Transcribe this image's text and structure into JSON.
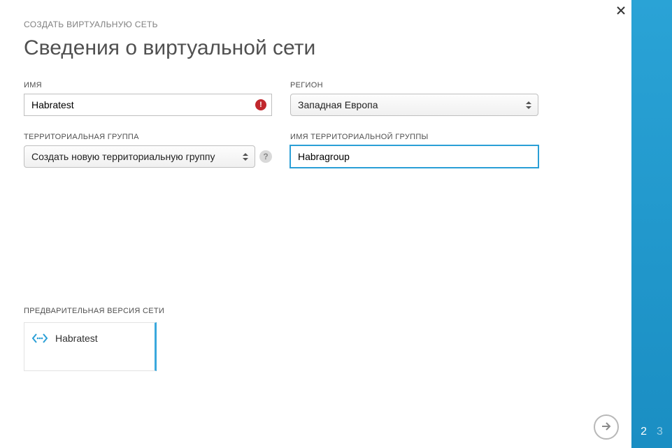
{
  "breadcrumb": "СОЗДАТЬ ВИРТУАЛЬНУЮ СЕТЬ",
  "title": "Сведения о виртуальной сети",
  "labels": {
    "name": "ИМЯ",
    "region": "РЕГИОН",
    "affinity_group": "ТЕРРИТОРИАЛЬНАЯ ГРУППА",
    "affinity_group_name": "ИМЯ ТЕРРИТОРИАЛЬНОЙ ГРУППЫ",
    "preview": "ПРЕДВАРИТЕЛЬНАЯ ВЕРСИЯ СЕТИ"
  },
  "fields": {
    "name_value": "Habratest",
    "name_error": true,
    "region_value": "Западная Европа",
    "affinity_group_value": "Создать новую территориальную группу",
    "affinity_group_name_value": "Habragroup"
  },
  "preview": {
    "name": "Habratest"
  },
  "steps": {
    "current": "2",
    "next": "3"
  },
  "icons": {
    "close": "close-icon",
    "error": "error-icon",
    "help": "help-icon",
    "arrow_right": "arrow-right-icon",
    "network": "network-icon",
    "caret": "caret-icon"
  },
  "colors": {
    "accent": "#2aa3d6",
    "error": "#c1272d"
  }
}
